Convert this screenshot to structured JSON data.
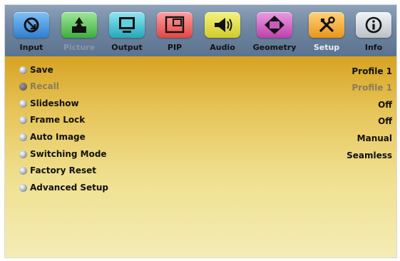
{
  "tabs": [
    {
      "label": "Input",
      "icon": "input-icon",
      "color": "#2f7fd0"
    },
    {
      "label": "Picture",
      "icon": "picture-icon",
      "color": "#43b843"
    },
    {
      "label": "Output",
      "icon": "output-icon",
      "color": "#2fb7c8"
    },
    {
      "label": "PIP",
      "icon": "pip-icon",
      "color": "#e74c4c"
    },
    {
      "label": "Audio",
      "icon": "audio-icon",
      "color": "#d7d63a"
    },
    {
      "label": "Geometry",
      "icon": "geometry-icon",
      "color": "#c64bb6"
    },
    {
      "label": "Setup",
      "icon": "setup-icon",
      "color": "#e99a1b"
    },
    {
      "label": "Info",
      "icon": "info-icon",
      "color": "#cfd4da"
    }
  ],
  "menu": [
    {
      "label": "Save",
      "value": "Profile 1"
    },
    {
      "label": "Recall",
      "value": "Profile 1"
    },
    {
      "label": "Slideshow",
      "value": "Off"
    },
    {
      "label": "Frame Lock",
      "value": "Off"
    },
    {
      "label": "Auto Image",
      "value": "Manual"
    },
    {
      "label": "Switching Mode",
      "value": "Seamless"
    },
    {
      "label": "Factory Reset",
      "value": ""
    },
    {
      "label": "Advanced Setup",
      "value": ""
    }
  ]
}
